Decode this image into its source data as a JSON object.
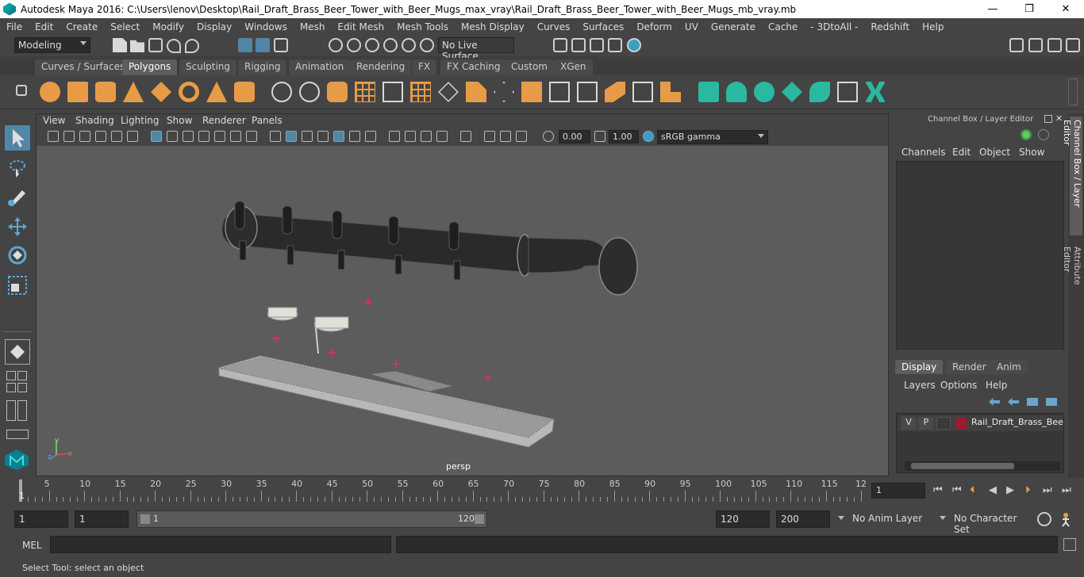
{
  "window": {
    "title": "Autodesk Maya 2016: C:\\Users\\lenov\\Desktop\\Rail_Draft_Brass_Beer_Tower_with_Beer_Mugs_max_vray\\Rail_Draft_Brass_Beer_Tower_with_Beer_Mugs_mb_vray.mb",
    "minimize": "—",
    "restore": "❐",
    "close": "✕"
  },
  "menubar": [
    "File",
    "Edit",
    "Create",
    "Select",
    "Modify",
    "Display",
    "Windows",
    "Mesh",
    "Edit Mesh",
    "Mesh Tools",
    "Mesh Display",
    "Curves",
    "Surfaces",
    "Deform",
    "UV",
    "Generate",
    "Cache",
    "- 3DtoAll -",
    "Redshift",
    "Help"
  ],
  "statusline": {
    "mode": "Modeling",
    "live_surface": "No Live Surface"
  },
  "shelf_tabs": [
    "Curves / Surfaces",
    "Polygons",
    "Sculpting",
    "Rigging",
    "Animation",
    "Rendering",
    "FX",
    "FX Caching",
    "Custom",
    "XGen"
  ],
  "active_shelf_tab": "Polygons",
  "panel_menu": [
    "View",
    "Shading",
    "Lighting",
    "Show",
    "Renderer",
    "Panels"
  ],
  "panel_toolbar": {
    "exposure": "0.00",
    "gamma": "1.00",
    "color_space": "sRGB gamma"
  },
  "viewport": {
    "camera_label": "persp",
    "axis_x": "x",
    "axis_y": "y",
    "axis_z": "z"
  },
  "channel_box": {
    "title": "Channel Box / Layer Editor",
    "menu": [
      "Channels",
      "Edit",
      "Object",
      "Show"
    ],
    "layer_tabs": [
      "Display",
      "Render",
      "Anim"
    ],
    "layer_menu": [
      "Layers",
      "Options",
      "Help"
    ],
    "layer_row": {
      "visibility": "V",
      "playback": "P",
      "name": "Rail_Draft_Brass_Beer_",
      "color": "#9b1b30"
    }
  },
  "side_tabs": [
    "Channel Box / Layer Editor",
    "Attribute Editor"
  ],
  "time_slider": {
    "labels": [
      "5",
      "10",
      "15",
      "20",
      "25",
      "30",
      "35",
      "40",
      "45",
      "50",
      "55",
      "60",
      "65",
      "70",
      "75",
      "80",
      "85",
      "90",
      "95",
      "100",
      "105",
      "110",
      "115",
      "12"
    ],
    "current_frame_marker": "1",
    "current_frame": "1"
  },
  "range_slider": {
    "start_frame": "1",
    "playback_start": "1",
    "range_start_label": "1",
    "range_end_label": "120",
    "playback_end": "120",
    "end_frame": "200",
    "anim_layer": "No Anim Layer",
    "character_set": "No Character Set"
  },
  "command_line": {
    "label": "MEL"
  },
  "help_line": {
    "text": "Select Tool: select an object"
  }
}
